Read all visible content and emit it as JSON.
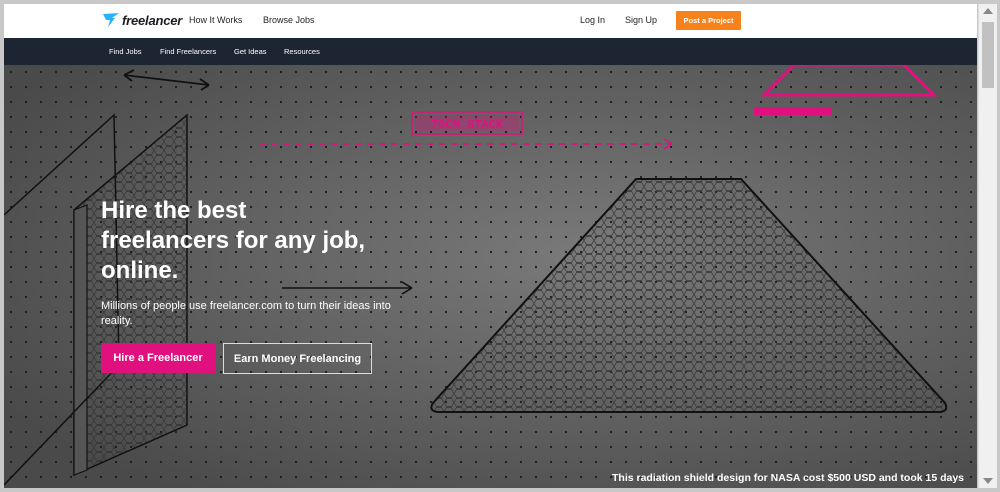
{
  "brand": {
    "name": "freelancer",
    "accent": "#29b2fe"
  },
  "header": {
    "nav": [
      "How It Works",
      "Browse Jobs"
    ],
    "login": "Log In",
    "signup": "Sign Up",
    "post_project": "Post a Project",
    "post_color": "#f7821b"
  },
  "subnav": [
    "Find Jobs",
    "Find Freelancers",
    "Get Ideas",
    "Resources"
  ],
  "hero": {
    "headline": [
      "Hire the best",
      "freelancers for any job,",
      "online."
    ],
    "subhead": "Millions of people use freelancer.com to turn their ideas into reality.",
    "primary_cta": "Hire a Freelancer",
    "secondary_cta": "Earn Money Freelancing",
    "primary_color": "#e0117f",
    "sketch_label": "75CM STACK",
    "caption": "This radiation shield design for NASA cost $500 USD and took 15 days"
  }
}
